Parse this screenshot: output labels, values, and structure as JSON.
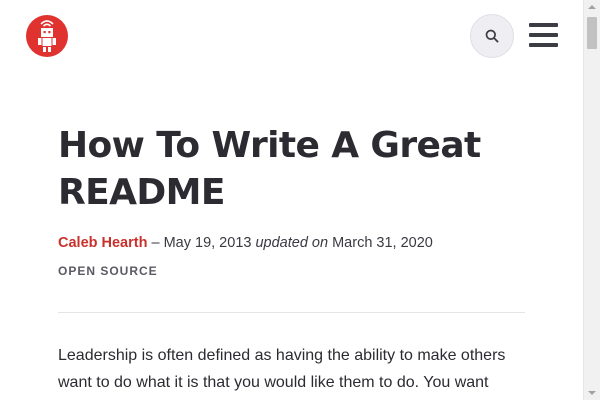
{
  "header": {
    "logo_icon": "robot-icon",
    "logo_color": "#e0322f",
    "search_icon": "search-icon",
    "menu_icon": "hamburger-menu-icon"
  },
  "article": {
    "title": "How To Write A Great README",
    "author": "Caleb Hearth",
    "separator": " – ",
    "published": "May 19, 2013",
    "updated_label": "updated on",
    "updated_date": "March 31, 2020",
    "category": "OPEN SOURCE",
    "body_lines": [
      "Leadership is often defined as having the ability to make others",
      "want to do what it is that you would like them to do. You want"
    ]
  },
  "colors": {
    "accent": "#c8312c",
    "text": "#2b2b31"
  }
}
